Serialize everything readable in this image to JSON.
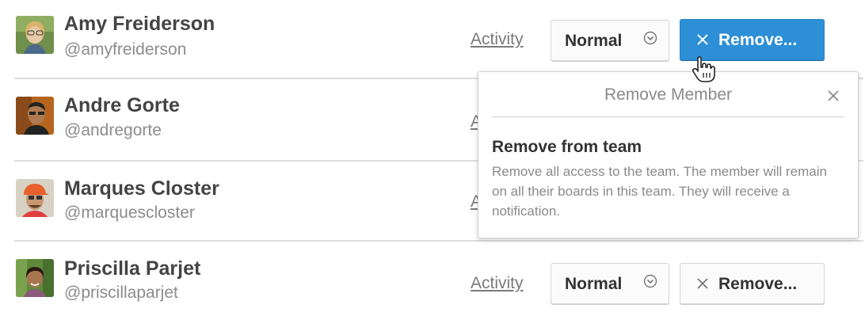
{
  "members": [
    {
      "name": "Amy Freiderson",
      "handle": "@amyfreiderson",
      "activity_label": "Activity",
      "role": "Normal",
      "remove_label": "Remove..."
    },
    {
      "name": "Andre Gorte",
      "handle": "@andregorte",
      "activity_label": "A"
    },
    {
      "name": "Marques Closter",
      "handle": "@marquescloster",
      "activity_label": "A"
    },
    {
      "name": "Priscilla Parjet",
      "handle": "@priscillaparjet",
      "activity_label": "Activity",
      "role": "Normal",
      "remove_label": "Remove..."
    }
  ],
  "popover": {
    "title": "Remove Member",
    "option_title": "Remove from team",
    "option_description": "Remove all access to the team. The member will remain on all their boards in this team. They will receive a notification."
  },
  "colors": {
    "primary_button": "#2d8fd6",
    "text_dark": "#444444",
    "text_muted": "#8c8c8c",
    "divider": "#dcdcdc"
  },
  "icons": {
    "role_dropdown": "chevron-down-circle-icon",
    "remove": "close-icon",
    "popover_close": "close-icon",
    "cursor": "hand-pointer-cursor-icon"
  }
}
